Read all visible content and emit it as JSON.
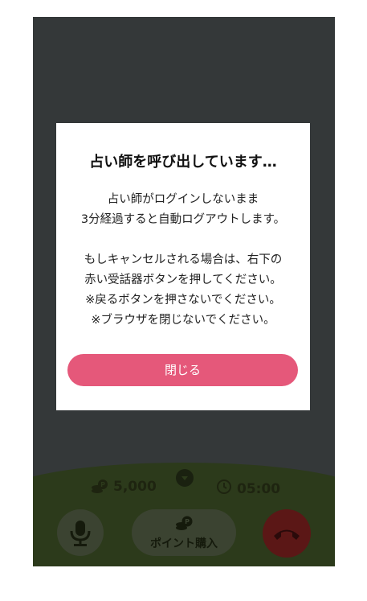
{
  "dialog": {
    "title": "占い師を呼び出しています…",
    "message_lines": [
      "占い師がログインしないまま",
      "3分経過すると自動ログアウトします。",
      "",
      "もしキャンセルされる場合は、右下の",
      "赤い受話器ボタンを押してください。",
      "※戻るボタンを押さないでください。",
      "※ブラウザを閉じないでください。"
    ],
    "close_label": "閉じる"
  },
  "call_bar": {
    "points": "5,000",
    "timer": "05:00",
    "buy_points_label": "ポイント購入"
  },
  "colors": {
    "accent": "#e5587a",
    "hangup": "#c92a26",
    "overlay": "#343839"
  }
}
